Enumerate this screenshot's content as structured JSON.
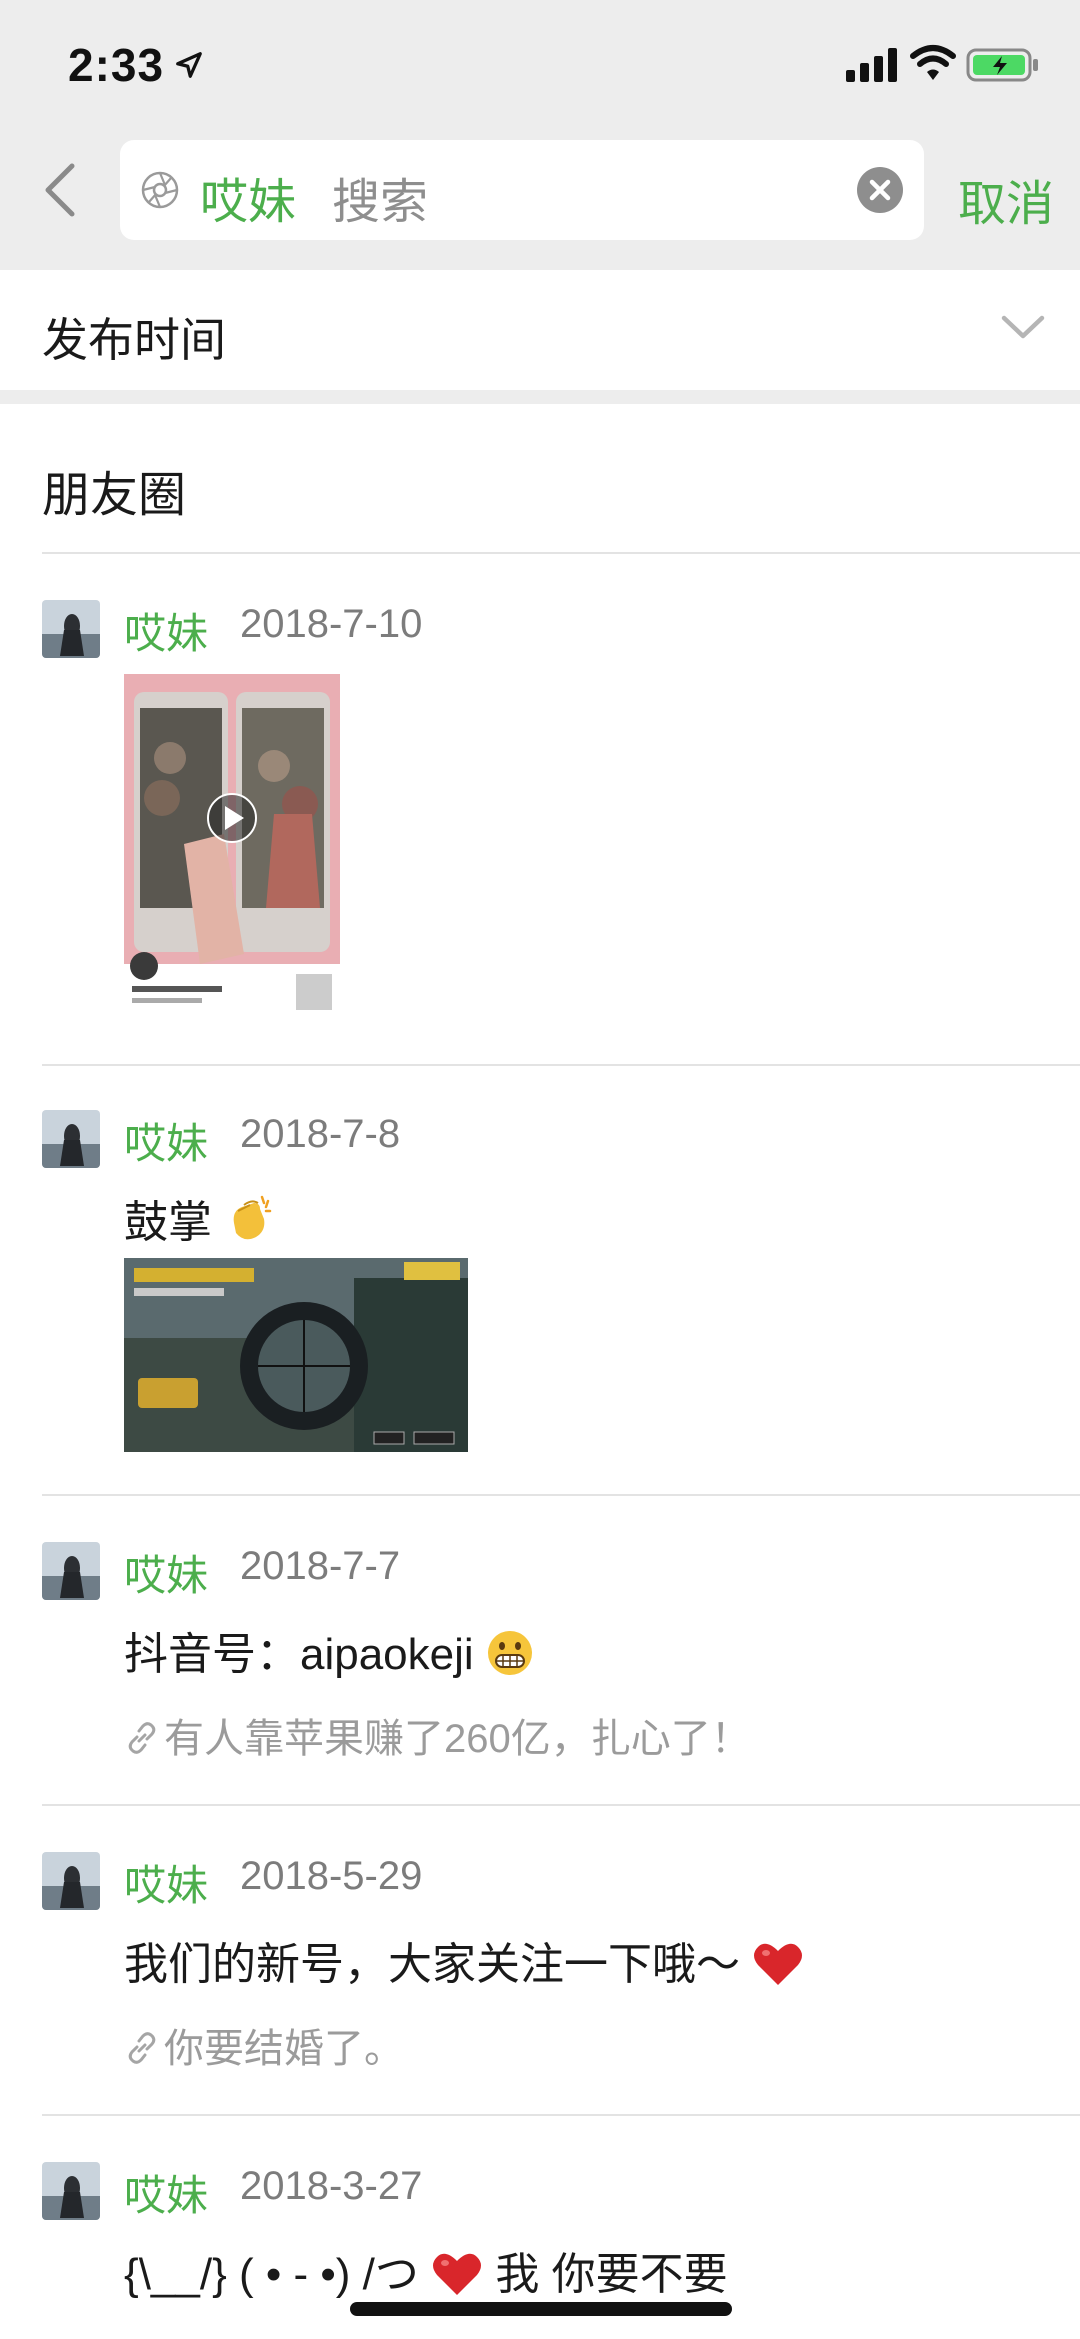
{
  "status_bar": {
    "time": "2:33"
  },
  "search": {
    "chip": "哎妹",
    "placeholder": "搜索",
    "cancel": "取消"
  },
  "filter": {
    "label": "发布时间"
  },
  "section": {
    "title": "朋友圈"
  },
  "posts": [
    {
      "name": "哎妹",
      "date": "2018-7-10"
    },
    {
      "name": "哎妹",
      "date": "2018-7-8",
      "text": "鼓掌"
    },
    {
      "name": "哎妹",
      "date": "2018-7-7",
      "text": "抖音号：aipaokeji",
      "link": "有人靠苹果赚了260亿，扎心了！"
    },
    {
      "name": "哎妹",
      "date": "2018-5-29",
      "text": "我们的新号，大家关注一下哦～",
      "link": "你要结婚了。"
    },
    {
      "name": "哎妹",
      "date": "2018-3-27",
      "text": "{\\__/} ( • - •) /つ",
      "text_tail": "我 你要不要"
    }
  ],
  "icons": {
    "back": "chevron-left-icon",
    "clear": "clear-icon",
    "filter": "chevron-down-icon",
    "link": "link-icon"
  },
  "colors": {
    "accent": "#4cae4c",
    "header_bg": "#ededed"
  }
}
